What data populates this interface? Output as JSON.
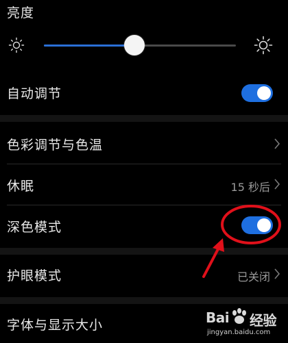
{
  "brightness": {
    "title": "亮度",
    "level": 0.47,
    "accent": "#2a6fd6"
  },
  "rows": {
    "auto_adjust": {
      "label": "自动调节",
      "toggle_on": true
    },
    "color_temp": {
      "label": "色彩调节与色温"
    },
    "sleep": {
      "label": "休眠",
      "value": "15 秒后"
    },
    "dark_mode": {
      "label": "深色模式",
      "toggle_on": true
    },
    "eye_comfort": {
      "label": "护眼模式",
      "value": "已关闭"
    },
    "font_size": {
      "label": "字体与显示大小"
    }
  },
  "colors": {
    "toggle_on": "#1e6fe0",
    "annotation": "#e0101a",
    "background": "#000000"
  },
  "watermark": {
    "brand": "Bai",
    "brand_suffix": "经验",
    "url": "jingyan.baidu.com"
  },
  "icons": {
    "brightness_low": "sun-small-icon",
    "brightness_high": "sun-large-icon",
    "chevron": "chevron-right-icon"
  }
}
